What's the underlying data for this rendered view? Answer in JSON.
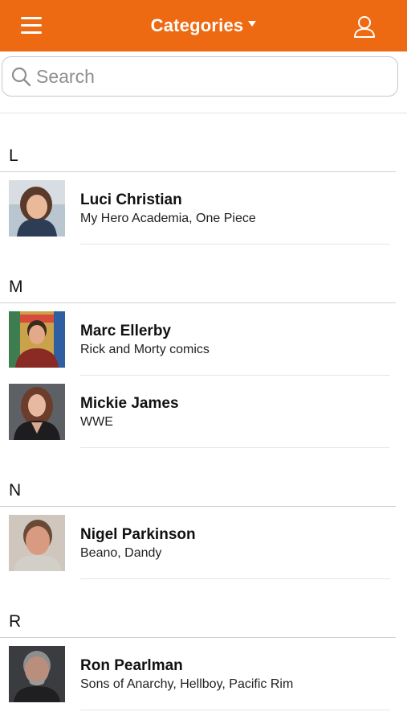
{
  "header": {
    "title": "Categories",
    "background_color": "#ee6a12",
    "menu_icon": "hamburger-menu-icon",
    "profile_icon": "user-profile-icon"
  },
  "search": {
    "placeholder": "Search",
    "value": ""
  },
  "sections": [
    {
      "letter": "L",
      "people": [
        {
          "name": "Luci Christian",
          "subtitle": "My Hero Academia, One Piece"
        }
      ]
    },
    {
      "letter": "M",
      "people": [
        {
          "name": "Marc Ellerby",
          "subtitle": "Rick and Morty comics"
        },
        {
          "name": "Mickie James",
          "subtitle": "WWE"
        }
      ]
    },
    {
      "letter": "N",
      "people": [
        {
          "name": "Nigel Parkinson",
          "subtitle": "Beano, Dandy"
        }
      ]
    },
    {
      "letter": "R",
      "people": [
        {
          "name": "Ron Pearlman",
          "subtitle": "Sons of Anarchy, Hellboy, Pacific Rim"
        }
      ]
    }
  ]
}
